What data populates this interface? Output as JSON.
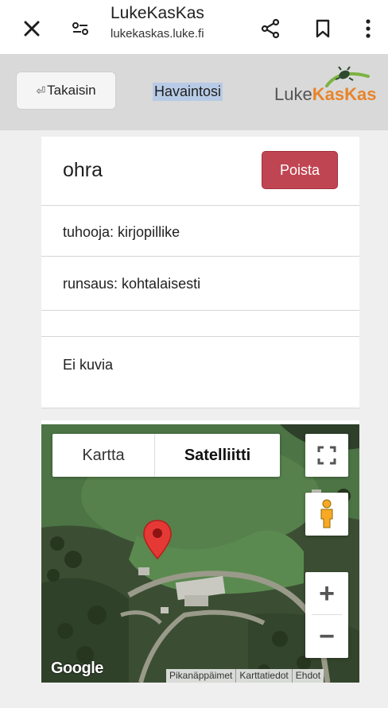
{
  "browser": {
    "title": "LukeKasKas",
    "url": "lukekaskas.luke.fi",
    "icons": [
      "close-icon",
      "site-settings-icon",
      "share-icon",
      "bookmark-icon",
      "more-vert-icon"
    ]
  },
  "header": {
    "back_label": "Takaisin",
    "back_icon": "⏎",
    "title": "Havaintosi",
    "logo_luke": "Luke",
    "logo_kaskas": "KasKas"
  },
  "observation": {
    "plant": "ohra",
    "delete_label": "Poista",
    "pest": "tuhooja: kirjopillike",
    "abundance": "runsaus: kohtalaisesti",
    "empty_row": "",
    "images": "Ei kuvia"
  },
  "map": {
    "type_map": "Kartta",
    "type_satellite": "Satelliitti",
    "google": "Google",
    "links": {
      "shortcuts": "Pikanäppäimet",
      "mapdata": "Karttatiedot",
      "terms": "Ehdot"
    },
    "zoom_in": "+",
    "zoom_out": "−"
  },
  "colors": {
    "delete": "#c04552",
    "header_bg": "#d9d9d9",
    "brand_orange": "#e8842a"
  }
}
